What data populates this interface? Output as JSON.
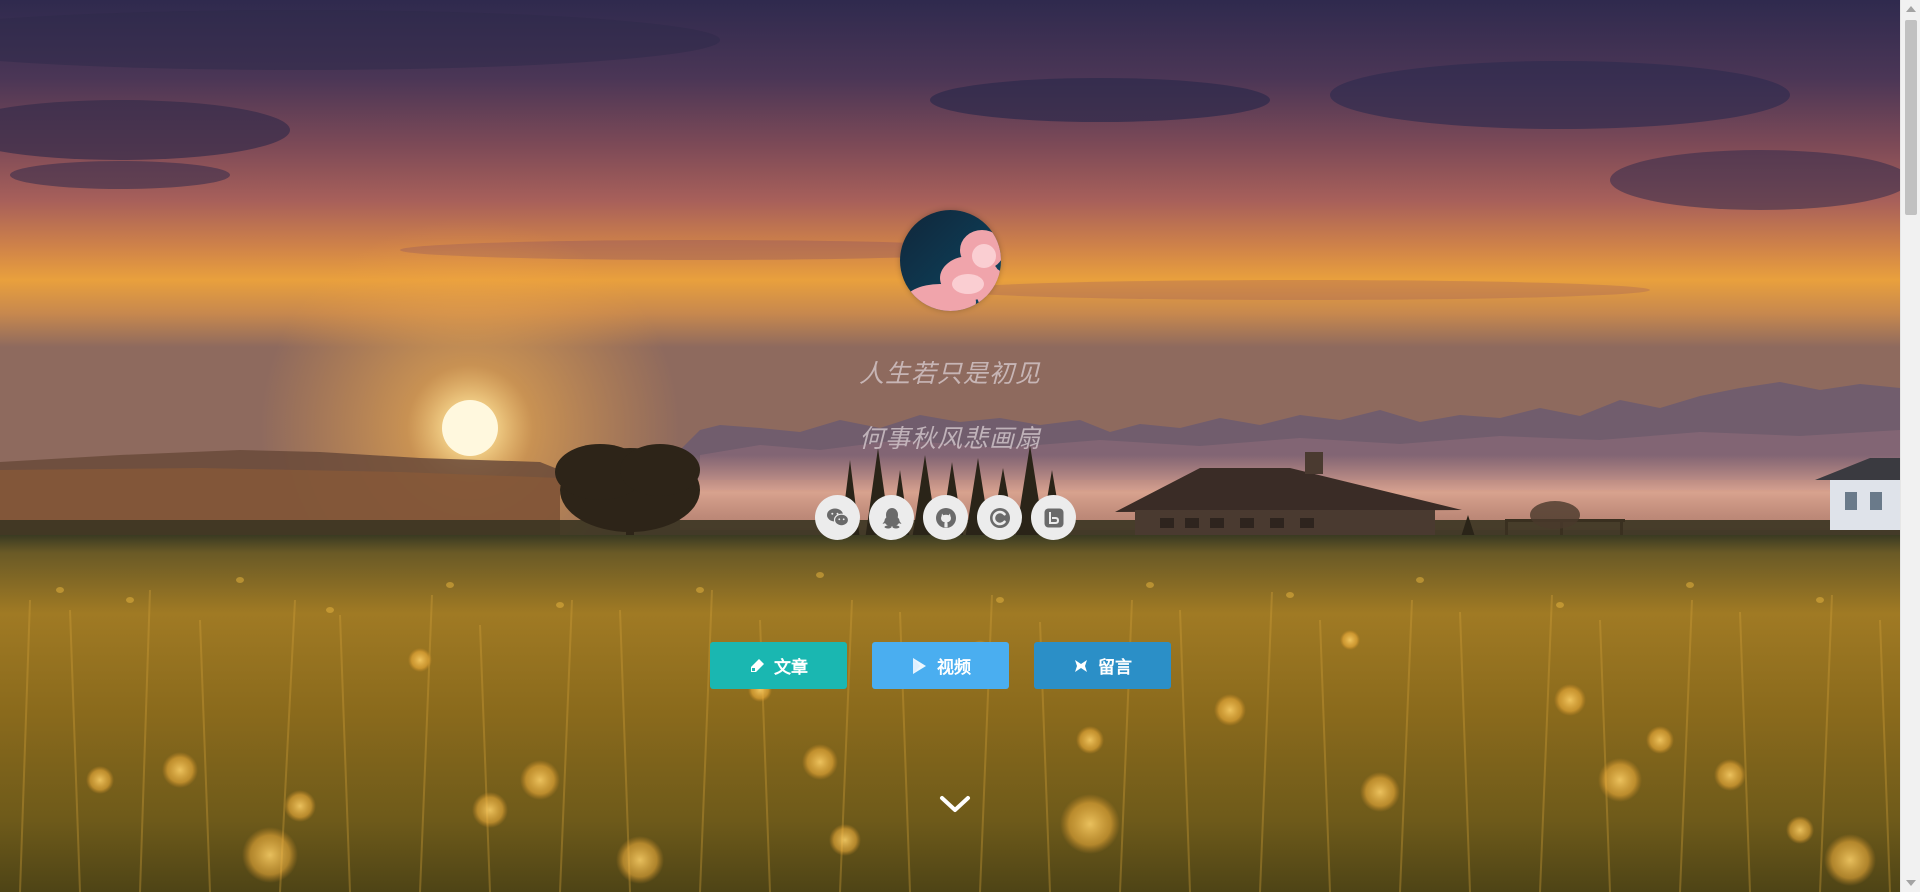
{
  "page": {
    "motto_line1": "人生若只是初见",
    "motto_line2": "何事秋风悲画扇"
  },
  "avatar": {
    "icon": "avatar-moon-cloud"
  },
  "social": [
    {
      "name": "wechat",
      "icon": "wechat-icon"
    },
    {
      "name": "qq",
      "icon": "qq-penguin-icon"
    },
    {
      "name": "github",
      "icon": "github-icon"
    },
    {
      "name": "csdn",
      "icon": "csdn-c-icon"
    },
    {
      "name": "bilibili",
      "icon": "bilibili-icon"
    }
  ],
  "nav": [
    {
      "label": "文章",
      "icon": "article-pen-icon",
      "color": "#1ab7b1"
    },
    {
      "label": "视频",
      "icon": "video-play-icon",
      "color": "#4aaef0"
    },
    {
      "label": "留言",
      "icon": "message-icon",
      "color": "#2b8fc7"
    }
  ],
  "colors": {
    "sky_top": "#3c2f5a",
    "sky_horizon": "#f2a440",
    "field": "#b07a1e"
  },
  "scroll_indicator": {
    "icon": "chevron-down-icon"
  }
}
